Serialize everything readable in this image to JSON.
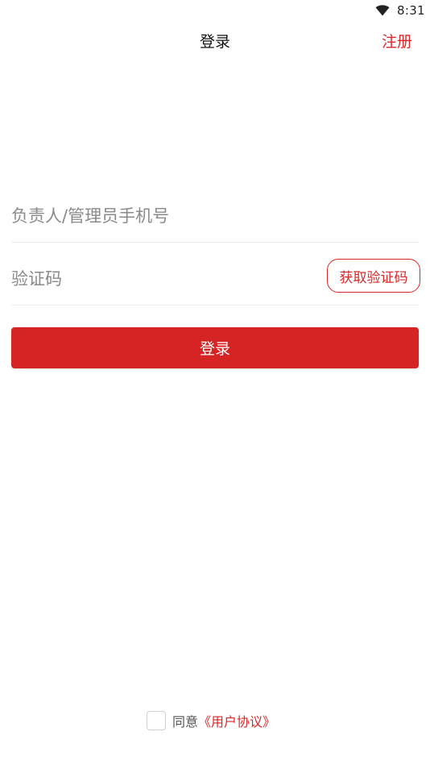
{
  "status_bar": {
    "time": "8:31",
    "wifi_icon": "wifi-icon"
  },
  "nav": {
    "title": "登录",
    "register_label": "注册"
  },
  "form": {
    "phone": {
      "placeholder": "负责人/管理员手机号",
      "value": ""
    },
    "code": {
      "placeholder": "验证码",
      "value": ""
    },
    "get_code_label": "获取验证码",
    "login_label": "登录"
  },
  "agreement": {
    "checked": false,
    "prefix": "同意",
    "link": "《用户协议》"
  },
  "colors": {
    "accent": "#d62828",
    "button_bg": "#d62424",
    "divider": "#ececec",
    "placeholder": "#8a8a8a"
  }
}
